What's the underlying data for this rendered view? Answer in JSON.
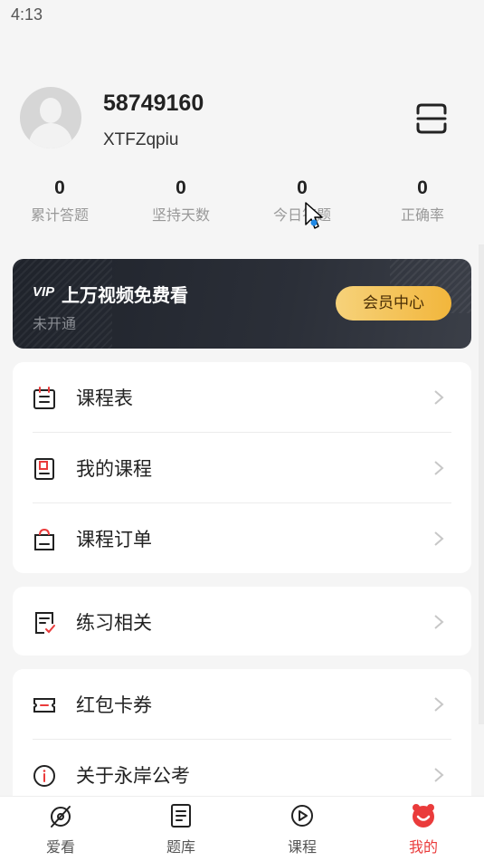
{
  "status_bar": {
    "time": "4:13"
  },
  "profile": {
    "user_id": "58749160",
    "username": "XTFZqpiu"
  },
  "stats": [
    {
      "value": "0",
      "label": "累计答题"
    },
    {
      "value": "0",
      "label": "坚持天数"
    },
    {
      "value": "0",
      "label": "今日答题"
    },
    {
      "value": "0",
      "label": "正确率"
    }
  ],
  "vip": {
    "badge": "VIP",
    "title": "上万视频免费看",
    "status": "未开通",
    "button_label": "会员中心"
  },
  "menu_group_1": [
    {
      "label": "课程表",
      "icon": "timetable-icon"
    },
    {
      "label": "我的课程",
      "icon": "my-course-icon"
    },
    {
      "label": "课程订单",
      "icon": "course-order-icon"
    }
  ],
  "menu_group_2": [
    {
      "label": "练习相关",
      "icon": "practice-icon"
    }
  ],
  "menu_group_3": [
    {
      "label": "红包卡券",
      "icon": "coupon-icon"
    },
    {
      "label": "关于永岸公考",
      "icon": "info-icon"
    }
  ],
  "tabbar": [
    {
      "label": "爱看",
      "icon": "watch-icon"
    },
    {
      "label": "题库",
      "icon": "question-bank-icon"
    },
    {
      "label": "课程",
      "icon": "course-play-icon"
    },
    {
      "label": "我的",
      "icon": "profile-face-icon",
      "active": true
    }
  ],
  "colors": {
    "accent": "#ea3b3b",
    "vip_gold": "#f2b63c",
    "vip_dark": "#1f232b",
    "background": "#f5f5f5"
  }
}
